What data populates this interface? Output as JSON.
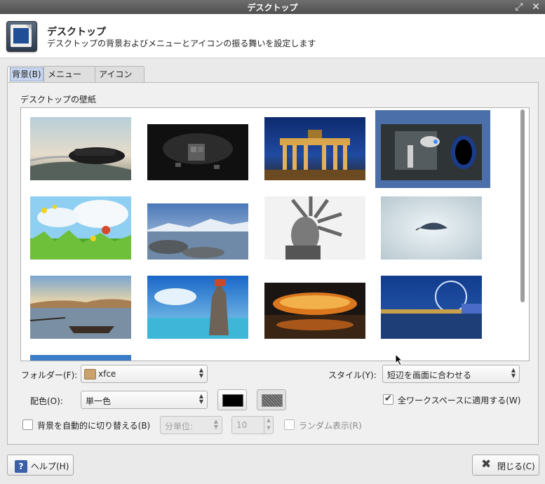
{
  "window": {
    "title": "デスクトップ",
    "maximize_icon": "maximize-icon",
    "close_icon": "close-icon"
  },
  "header": {
    "title": "デスクトップ",
    "subtitle": "デスクトップの背景およびメニューとアイコンの振る舞いを設定します"
  },
  "tabs": [
    {
      "label": "背景(B)",
      "active": true
    },
    {
      "label": "メニュー(M)",
      "active": false
    },
    {
      "label": "アイコン(I)",
      "active": false
    }
  ],
  "background": {
    "section_label": "デスクトップの壁紙",
    "wallpapers": [
      "sports-car",
      "cubes",
      "brandenburg-gate",
      "portal-robot",
      "flower-meadow",
      "mountain-lake",
      "statue-of-liberty",
      "feather",
      "lake-boat",
      "rock-island",
      "birds-nest-stadium",
      "london-eye"
    ],
    "selected_index": 3,
    "folder_label": "フォルダー(F):",
    "folder_value": "xfce",
    "style_label": "スタイル(Y):",
    "style_value": "短辺を画面に合わせる",
    "color_label": "配色(O):",
    "color_value": "単一色",
    "apply_all_label": "全ワークスペースに適用する(W)",
    "apply_all_checked": true,
    "auto_change_label": "背景を自動的に切り替える(B)",
    "auto_change_checked": false,
    "interval_unit": "分単位:",
    "interval_value": "10",
    "random_label": "ランダム表示(R)",
    "random_checked": false,
    "primary_color": "#000000"
  },
  "footer": {
    "help_label": "ヘルプ(H)",
    "close_label": "閉じる(C)"
  }
}
